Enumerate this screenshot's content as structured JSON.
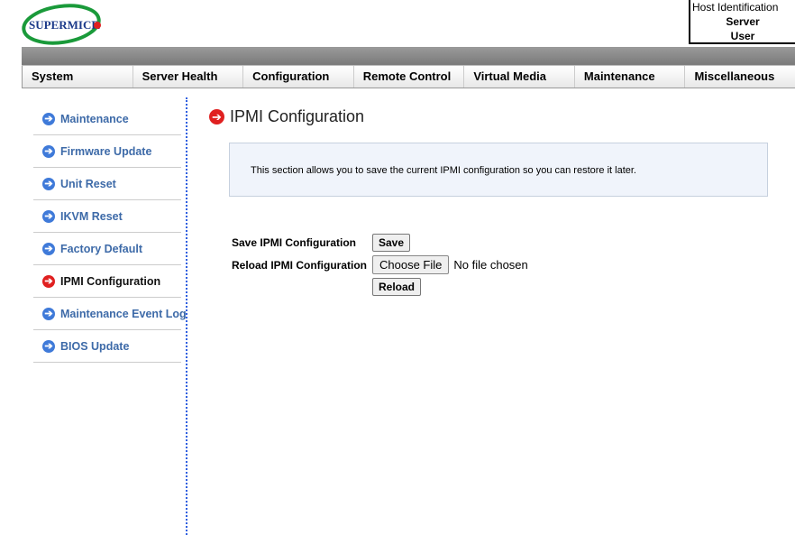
{
  "logo": {
    "text": "SUPERMICRO"
  },
  "host": {
    "line1": "Host Identification",
    "line2": "Server",
    "line3": "User"
  },
  "nav": [
    "System",
    "Server Health",
    "Configuration",
    "Remote Control",
    "Virtual Media",
    "Maintenance",
    "Miscellaneous"
  ],
  "sidebar": {
    "items": [
      {
        "label": "Maintenance"
      },
      {
        "label": "Firmware Update"
      },
      {
        "label": "Unit Reset"
      },
      {
        "label": "IKVM Reset"
      },
      {
        "label": "Factory Default"
      },
      {
        "label": "IPMI Configuration",
        "active": true
      },
      {
        "label": "Maintenance Event Log"
      },
      {
        "label": "BIOS Update"
      }
    ]
  },
  "page": {
    "title": "IPMI Configuration",
    "info": "This section allows you to save the current IPMI configuration so you can restore it later.",
    "save_label": "Save IPMI Configuration",
    "save_button": "Save",
    "reload_label": "Reload IPMI Configuration",
    "choose_file": "Choose File",
    "file_status": "No file chosen",
    "reload_button": "Reload"
  },
  "colors": {
    "link": "#3d6aa8",
    "active_icon": "#e02020",
    "icon": "#3f7ad9"
  }
}
